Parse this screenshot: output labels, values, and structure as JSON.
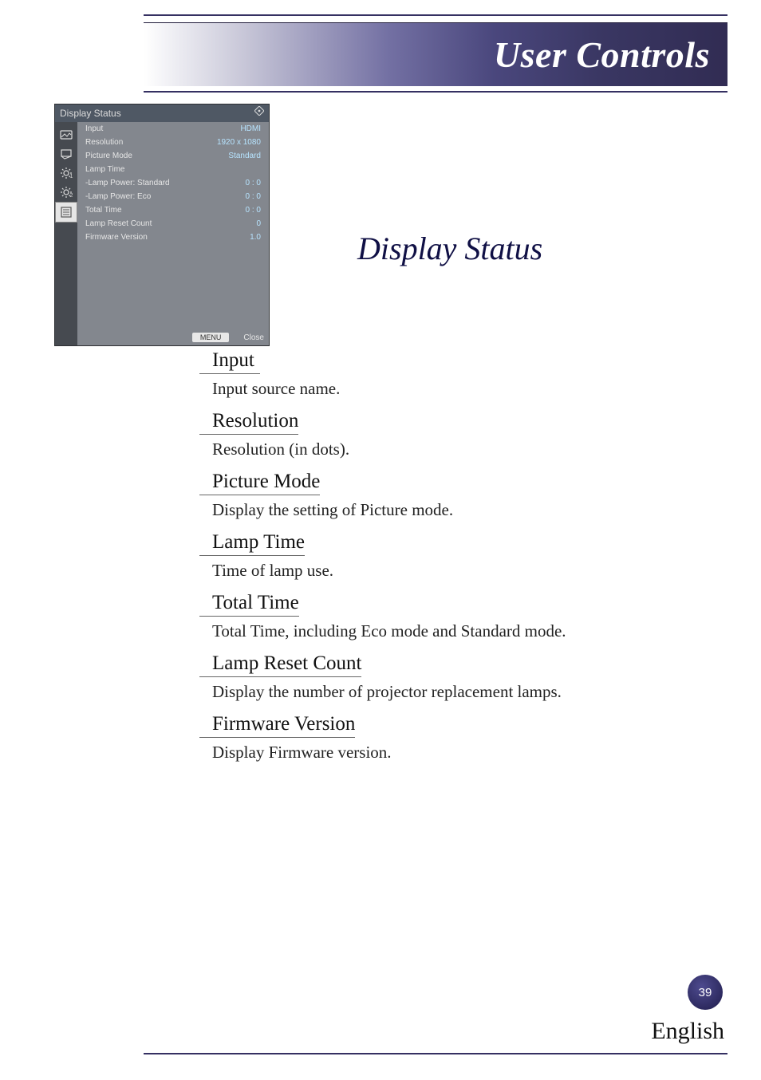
{
  "header": {
    "title": "User Controls"
  },
  "section": {
    "title": "Display Status"
  },
  "osd": {
    "title": "Display Status",
    "rows": [
      {
        "label": "Input",
        "value": "HDMI"
      },
      {
        "label": "Resolution",
        "value": "1920 x 1080"
      },
      {
        "label": "Picture Mode",
        "value": "Standard"
      },
      {
        "label": "Lamp Time",
        "value": ""
      },
      {
        "label": "-Lamp Power: Standard",
        "value": "0 : 0"
      },
      {
        "label": "-Lamp Power: Eco",
        "value": "0 : 0"
      },
      {
        "label": "Total Time",
        "value": "0 : 0"
      },
      {
        "label": "Lamp Reset Count",
        "value": "0"
      },
      {
        "label": "Firmware Version",
        "value": "1.0"
      }
    ],
    "footer_button": "MENU",
    "footer_close": "Close"
  },
  "topics": [
    {
      "title": "Input",
      "desc": "Input source name."
    },
    {
      "title": "Resolution",
      "desc": "Resolution (in dots)."
    },
    {
      "title": "Picture Mode",
      "desc": "Display the setting of Picture mode."
    },
    {
      "title": "Lamp Time",
      "desc": "Time of lamp use."
    },
    {
      "title": "Total Time",
      "desc": "Total Time, including Eco mode and Standard mode."
    },
    {
      "title": "Lamp Reset Count",
      "desc": "Display the number of projector replacement lamps."
    },
    {
      "title": "Firmware Version",
      "desc": "Display Firmware version."
    }
  ],
  "footer": {
    "page": "39",
    "language": "English"
  }
}
